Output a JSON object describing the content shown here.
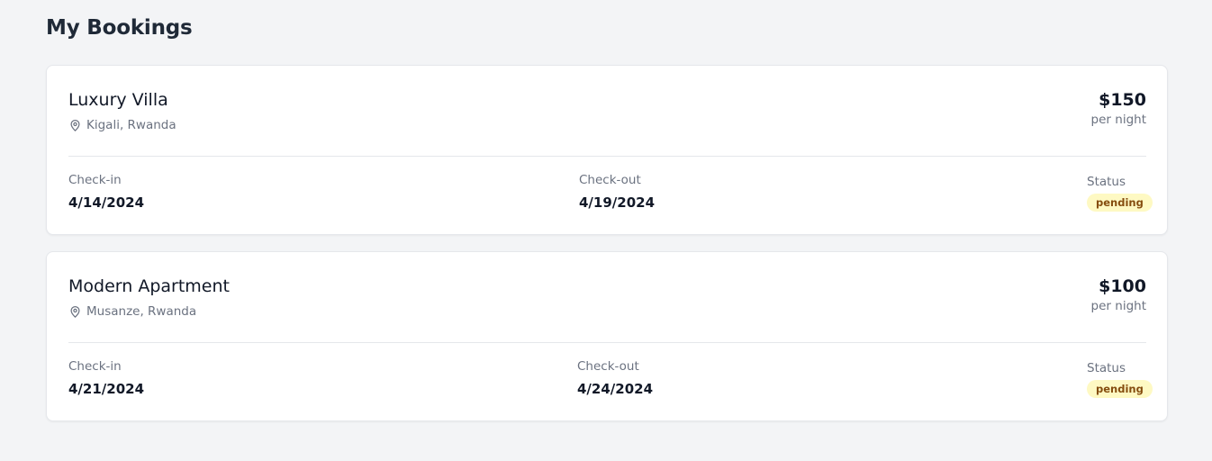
{
  "page": {
    "title": "My Bookings"
  },
  "bookings": [
    {
      "property_name": "Luxury Villa",
      "location": "Kigali, Rwanda",
      "price": "$150",
      "price_unit": "per night",
      "check_in_label": "Check-in",
      "check_in": "4/14/2024",
      "check_out_label": "Check-out",
      "check_out": "4/19/2024",
      "status_label": "Status",
      "status": "pending"
    },
    {
      "property_name": "Modern Apartment",
      "location": "Musanze, Rwanda",
      "price": "$100",
      "price_unit": "per night",
      "check_in_label": "Check-in",
      "check_in": "4/21/2024",
      "check_out_label": "Check-out",
      "check_out": "4/24/2024",
      "status_label": "Status",
      "status": "pending"
    }
  ],
  "icons": {
    "location": "map-pin-icon"
  },
  "colors": {
    "background": "#f3f4f6",
    "card": "#ffffff",
    "text_primary": "#111827",
    "text_secondary": "#6b7280",
    "badge_pending_bg": "#fef9c3",
    "badge_pending_text": "#854d0e"
  }
}
